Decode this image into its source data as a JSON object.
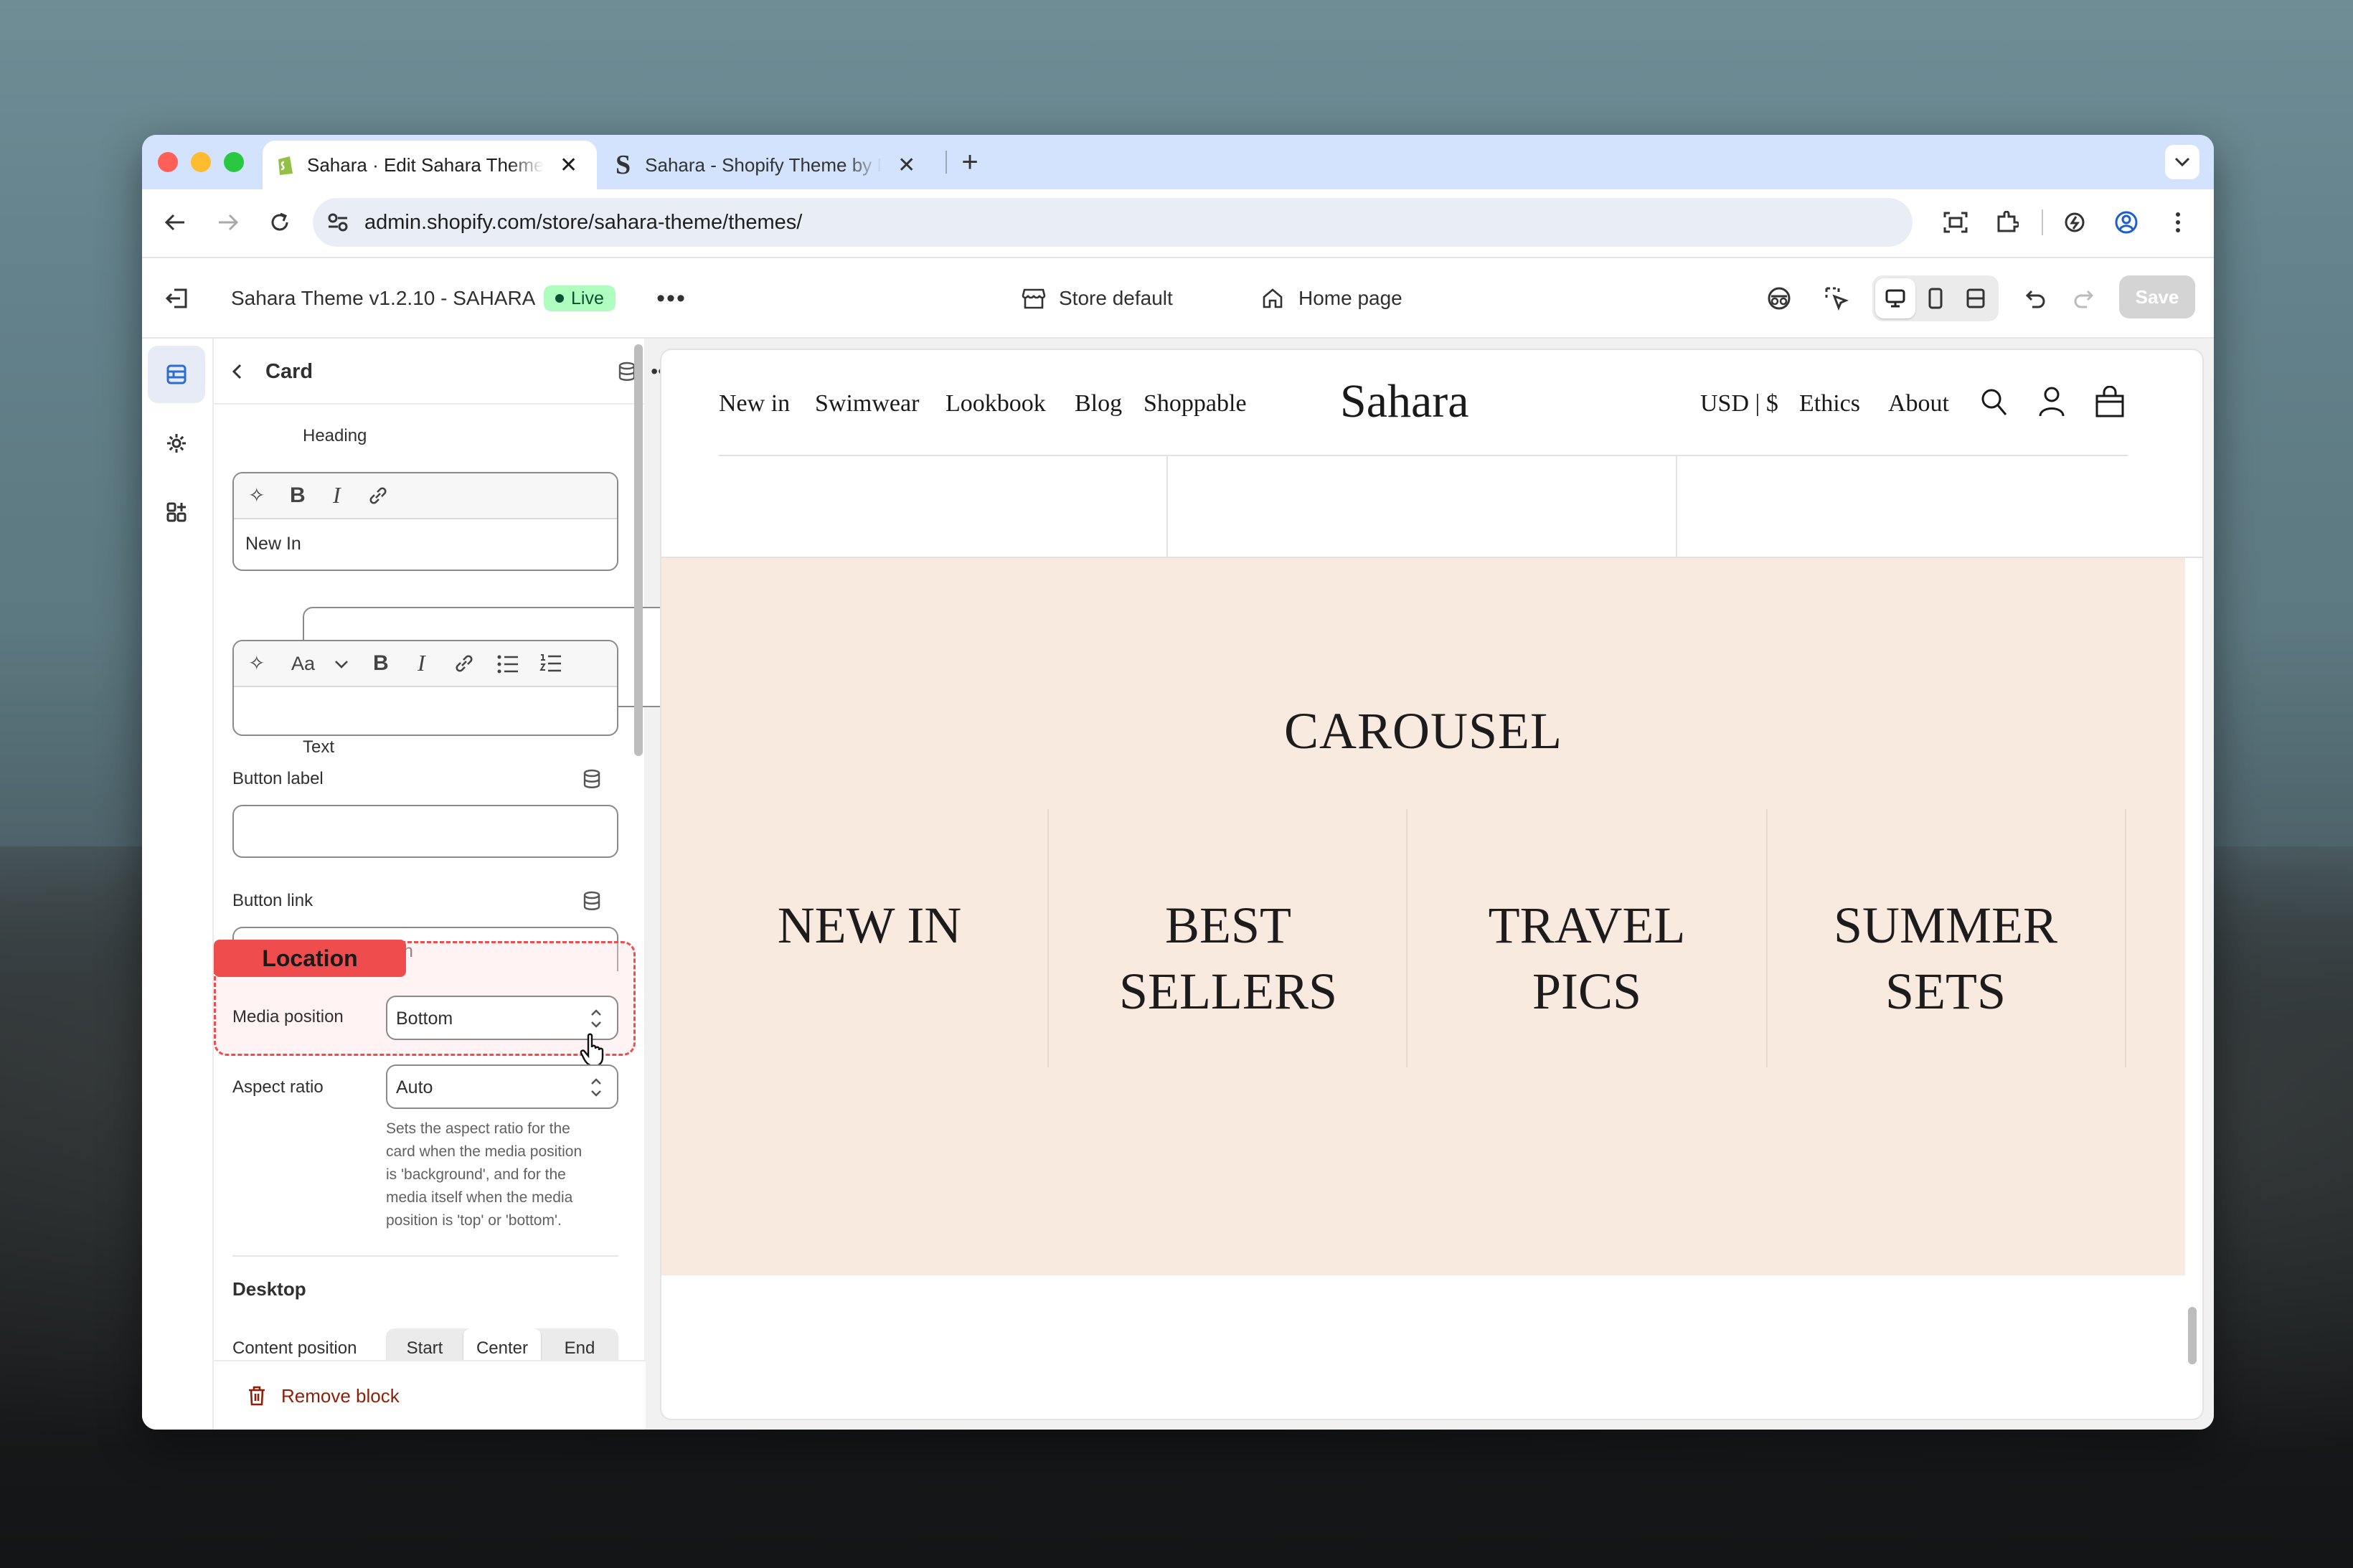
{
  "browser": {
    "tabs": [
      {
        "title": "Sahara · Edit Sahara Theme v"
      },
      {
        "title": "Sahara - Shopify Theme by D"
      }
    ],
    "url": "admin.shopify.com/store/sahara-theme/themes/"
  },
  "editor": {
    "theme_name": "Sahara Theme v1.2.10 - SAHARA",
    "status_badge": "Live",
    "store_selector": "Store default",
    "page_selector": "Home page",
    "save_label": "Save"
  },
  "panel": {
    "title": "Card",
    "heading_label": "Heading",
    "heading_value": "New In",
    "text_label": "Text",
    "text_value": "",
    "button_label_label": "Button label",
    "button_label_value": "",
    "button_link_label": "Button link",
    "button_link_partial": "h",
    "annotation": "Location",
    "media_position_label": "Media position",
    "media_position_value": "Bottom",
    "aspect_ratio_label": "Aspect ratio",
    "aspect_ratio_value": "Auto",
    "aspect_ratio_help": [
      "Sets the aspect ratio for the",
      "card when the media position",
      "is 'background', and for the",
      "media itself when the media",
      "position is 'top' or 'bottom'."
    ],
    "desktop_heading": "Desktop",
    "content_position_label": "Content position",
    "content_position_options": [
      "Start",
      "Center",
      "End"
    ],
    "content_position_selected": "Center",
    "remove_block": "Remove block"
  },
  "preview": {
    "nav_left": [
      "New in",
      "Swimwear",
      "Lookbook",
      "Blog",
      "Shoppable"
    ],
    "logo": "Sahara",
    "nav_right": [
      "USD | $",
      "Ethics",
      "About"
    ],
    "carousel_title": "CAROUSEL",
    "cards": [
      {
        "lines": [
          "NEW IN"
        ]
      },
      {
        "lines": [
          "BEST",
          "SELLERS"
        ]
      },
      {
        "lines": [
          "TRAVEL",
          "PICS"
        ]
      },
      {
        "lines": [
          "SUMMER",
          "SETS"
        ]
      }
    ]
  },
  "colors": {
    "live_badge": "#affebf",
    "annotation": "#ef4d4d",
    "carousel_bg": "#f8eadf",
    "remove": "#8e1f0b"
  }
}
